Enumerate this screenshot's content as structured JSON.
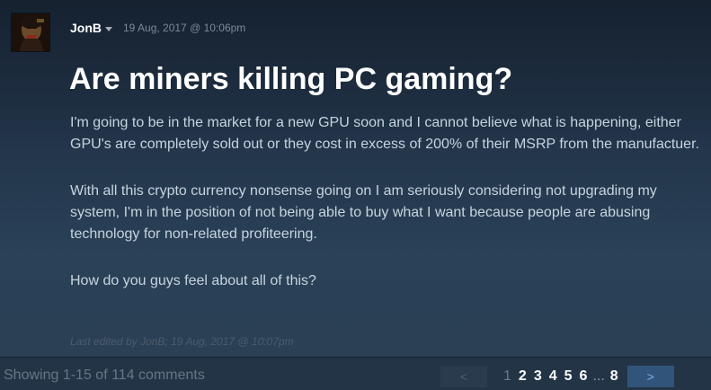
{
  "post": {
    "author": "JonB",
    "date": "19 Aug, 2017 @ 10:06pm",
    "title": "Are miners killing PC gaming?",
    "paragraphs": [
      "I'm going to be in the market for a new GPU soon and I cannot believe what is happening, either GPU's are completely sold out or they cost in excess of 200% of their MSRP from the manufactuer.",
      "With all this crypto currency nonsense going on I am seriously considering not upgrading my system, I'm in the position of not being able to buy what I want because people are abusing technology for non-related profiteering.",
      "How do you guys feel about all of this?"
    ],
    "last_edited_prefix": "Last edited by ",
    "last_edited_by": "JonB",
    "last_edited_date": "; 19 Aug, 2017 @ 10:07pm"
  },
  "footer": {
    "showing_text": "Showing 1-15 of 114 comments"
  },
  "pagination": {
    "prev_label": "<",
    "next_label": ">",
    "pages": [
      "1",
      "2",
      "3",
      "4",
      "5",
      "6"
    ],
    "ellipsis": "...",
    "last_page": "8",
    "current_page": "1"
  },
  "icons": {
    "avatar": "avatar-image",
    "caret": "caret-down-icon"
  },
  "colors": {
    "background_top": "#1c2a3b",
    "background_bottom": "#2b3f53",
    "title": "#ffffff",
    "body_text": "#c6d4df",
    "next_button": "#31547a"
  }
}
